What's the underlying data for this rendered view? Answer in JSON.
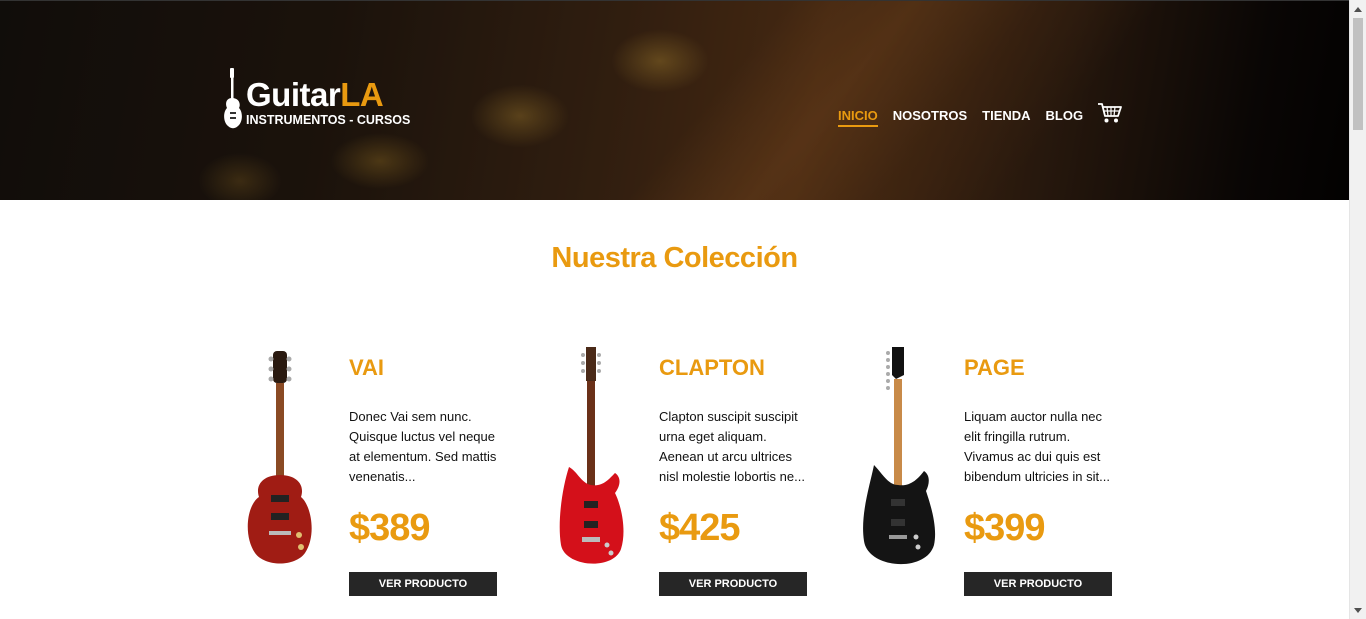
{
  "header": {
    "brand_main": "Guitar",
    "brand_accent": "LA",
    "tagline": "INSTRUMENTOS - CURSOS",
    "nav": [
      {
        "label": "INICIO",
        "active": true
      },
      {
        "label": "NOSOTROS",
        "active": false
      },
      {
        "label": "TIENDA",
        "active": false
      },
      {
        "label": "BLOG",
        "active": false
      }
    ],
    "cart_icon": "shopping-cart-icon"
  },
  "main": {
    "title": "Nuestra Colección",
    "products": [
      {
        "name": "VAI",
        "description": "Donec Vai sem nunc. Quisque luctus vel neque at elementum. Sed mattis venenatis...",
        "price": "$389",
        "button": "VER PRODUCTO",
        "body_color": "#a01c14"
      },
      {
        "name": "CLAPTON",
        "description": "Clapton suscipit suscipit urna eget aliquam. Aenean ut arcu ultrices nisl molestie lobortis ne...",
        "price": "$425",
        "button": "VER PRODUCTO",
        "body_color": "#d4101a"
      },
      {
        "name": "PAGE",
        "description": "Liquam auctor nulla nec elit fringilla rutrum. Vivamus ac dui quis est bibendum ultricies in sit...",
        "price": "$399",
        "button": "VER PRODUCTO",
        "body_color": "#141414"
      }
    ]
  },
  "colors": {
    "accent": "#e99a10",
    "button_bg": "#262626"
  }
}
